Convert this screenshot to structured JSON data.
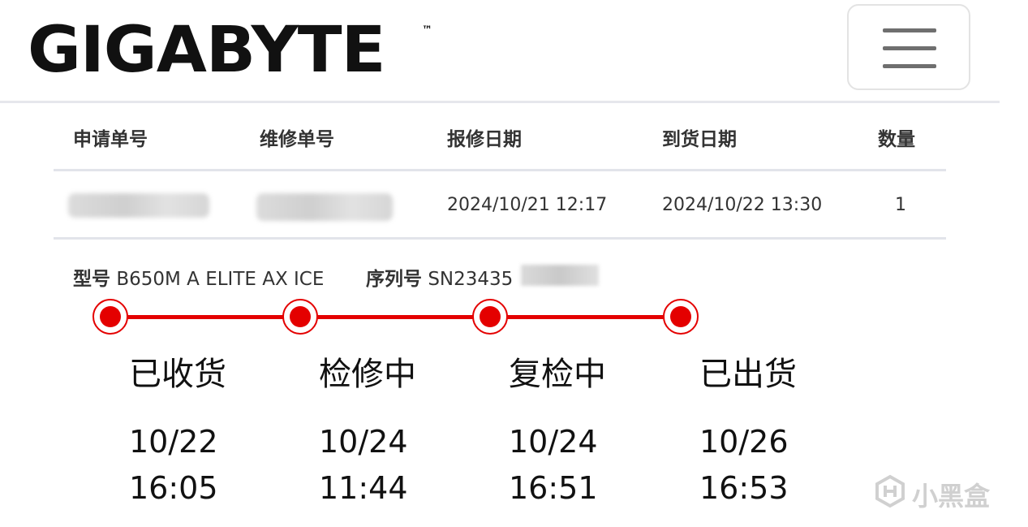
{
  "header": {
    "logo_text": "GIGABYTE",
    "trademark": "™",
    "menu_icon": "hamburger-menu-icon"
  },
  "table": {
    "headers": [
      "申请单号",
      "维修单号",
      "报修日期",
      "到货日期",
      "数量"
    ],
    "row": {
      "application_no": "",
      "repair_no": "",
      "report_date": "2024/10/21 12:17",
      "arrival_date": "2024/10/22 13:30",
      "quantity": "1"
    }
  },
  "product": {
    "model_label": "型号",
    "model_value": "B650M A ELITE AX ICE",
    "serial_label": "序列号",
    "serial_value": "SN23435"
  },
  "timeline": {
    "accent_color": "#e40000",
    "stages": [
      {
        "label": "已收货",
        "date": "10/22",
        "time": "16:05"
      },
      {
        "label": "检修中",
        "date": "10/24",
        "time": "11:44"
      },
      {
        "label": "复检中",
        "date": "10/24",
        "time": "16:51"
      },
      {
        "label": "已出货",
        "date": "10/26",
        "time": "16:53"
      }
    ]
  },
  "watermark": {
    "text": "小黑盒",
    "icon": "xiaoheihe-logo-icon"
  }
}
